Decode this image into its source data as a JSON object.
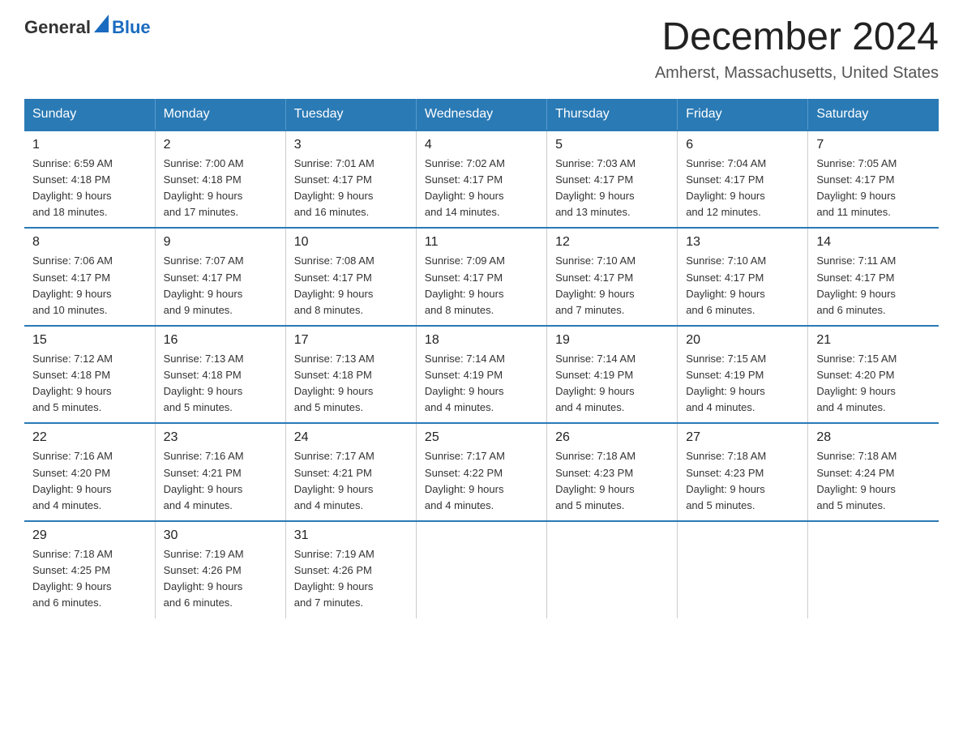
{
  "header": {
    "logo_general": "General",
    "logo_blue": "Blue",
    "month_title": "December 2024",
    "location": "Amherst, Massachusetts, United States"
  },
  "days_of_week": [
    "Sunday",
    "Monday",
    "Tuesday",
    "Wednesday",
    "Thursday",
    "Friday",
    "Saturday"
  ],
  "weeks": [
    [
      {
        "day": "1",
        "sunrise": "6:59 AM",
        "sunset": "4:18 PM",
        "daylight": "9 hours and 18 minutes."
      },
      {
        "day": "2",
        "sunrise": "7:00 AM",
        "sunset": "4:18 PM",
        "daylight": "9 hours and 17 minutes."
      },
      {
        "day": "3",
        "sunrise": "7:01 AM",
        "sunset": "4:17 PM",
        "daylight": "9 hours and 16 minutes."
      },
      {
        "day": "4",
        "sunrise": "7:02 AM",
        "sunset": "4:17 PM",
        "daylight": "9 hours and 14 minutes."
      },
      {
        "day": "5",
        "sunrise": "7:03 AM",
        "sunset": "4:17 PM",
        "daylight": "9 hours and 13 minutes."
      },
      {
        "day": "6",
        "sunrise": "7:04 AM",
        "sunset": "4:17 PM",
        "daylight": "9 hours and 12 minutes."
      },
      {
        "day": "7",
        "sunrise": "7:05 AM",
        "sunset": "4:17 PM",
        "daylight": "9 hours and 11 minutes."
      }
    ],
    [
      {
        "day": "8",
        "sunrise": "7:06 AM",
        "sunset": "4:17 PM",
        "daylight": "9 hours and 10 minutes."
      },
      {
        "day": "9",
        "sunrise": "7:07 AM",
        "sunset": "4:17 PM",
        "daylight": "9 hours and 9 minutes."
      },
      {
        "day": "10",
        "sunrise": "7:08 AM",
        "sunset": "4:17 PM",
        "daylight": "9 hours and 8 minutes."
      },
      {
        "day": "11",
        "sunrise": "7:09 AM",
        "sunset": "4:17 PM",
        "daylight": "9 hours and 8 minutes."
      },
      {
        "day": "12",
        "sunrise": "7:10 AM",
        "sunset": "4:17 PM",
        "daylight": "9 hours and 7 minutes."
      },
      {
        "day": "13",
        "sunrise": "7:10 AM",
        "sunset": "4:17 PM",
        "daylight": "9 hours and 6 minutes."
      },
      {
        "day": "14",
        "sunrise": "7:11 AM",
        "sunset": "4:17 PM",
        "daylight": "9 hours and 6 minutes."
      }
    ],
    [
      {
        "day": "15",
        "sunrise": "7:12 AM",
        "sunset": "4:18 PM",
        "daylight": "9 hours and 5 minutes."
      },
      {
        "day": "16",
        "sunrise": "7:13 AM",
        "sunset": "4:18 PM",
        "daylight": "9 hours and 5 minutes."
      },
      {
        "day": "17",
        "sunrise": "7:13 AM",
        "sunset": "4:18 PM",
        "daylight": "9 hours and 5 minutes."
      },
      {
        "day": "18",
        "sunrise": "7:14 AM",
        "sunset": "4:19 PM",
        "daylight": "9 hours and 4 minutes."
      },
      {
        "day": "19",
        "sunrise": "7:14 AM",
        "sunset": "4:19 PM",
        "daylight": "9 hours and 4 minutes."
      },
      {
        "day": "20",
        "sunrise": "7:15 AM",
        "sunset": "4:19 PM",
        "daylight": "9 hours and 4 minutes."
      },
      {
        "day": "21",
        "sunrise": "7:15 AM",
        "sunset": "4:20 PM",
        "daylight": "9 hours and 4 minutes."
      }
    ],
    [
      {
        "day": "22",
        "sunrise": "7:16 AM",
        "sunset": "4:20 PM",
        "daylight": "9 hours and 4 minutes."
      },
      {
        "day": "23",
        "sunrise": "7:16 AM",
        "sunset": "4:21 PM",
        "daylight": "9 hours and 4 minutes."
      },
      {
        "day": "24",
        "sunrise": "7:17 AM",
        "sunset": "4:21 PM",
        "daylight": "9 hours and 4 minutes."
      },
      {
        "day": "25",
        "sunrise": "7:17 AM",
        "sunset": "4:22 PM",
        "daylight": "9 hours and 4 minutes."
      },
      {
        "day": "26",
        "sunrise": "7:18 AM",
        "sunset": "4:23 PM",
        "daylight": "9 hours and 5 minutes."
      },
      {
        "day": "27",
        "sunrise": "7:18 AM",
        "sunset": "4:23 PM",
        "daylight": "9 hours and 5 minutes."
      },
      {
        "day": "28",
        "sunrise": "7:18 AM",
        "sunset": "4:24 PM",
        "daylight": "9 hours and 5 minutes."
      }
    ],
    [
      {
        "day": "29",
        "sunrise": "7:18 AM",
        "sunset": "4:25 PM",
        "daylight": "9 hours and 6 minutes."
      },
      {
        "day": "30",
        "sunrise": "7:19 AM",
        "sunset": "4:26 PM",
        "daylight": "9 hours and 6 minutes."
      },
      {
        "day": "31",
        "sunrise": "7:19 AM",
        "sunset": "4:26 PM",
        "daylight": "9 hours and 7 minutes."
      },
      null,
      null,
      null,
      null
    ]
  ]
}
